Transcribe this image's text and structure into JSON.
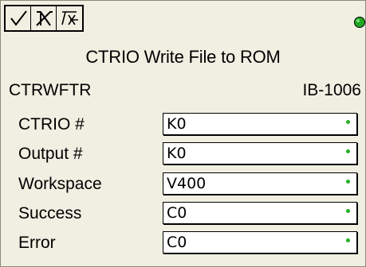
{
  "toolbar": {
    "buttons": [
      {
        "name": "accept-button",
        "icon": "check-icon"
      },
      {
        "name": "cancel-button",
        "icon": "x-icon"
      },
      {
        "name": "help-button",
        "icon": "help-icon"
      }
    ],
    "status_color": "#22a822"
  },
  "title": "CTRIO Write File to ROM",
  "mnemonic": "CTRWFTR",
  "ib_number": "IB-1006",
  "params": [
    {
      "label": "CTRIO #",
      "value": "K0"
    },
    {
      "label": "Output #",
      "value": "K0"
    },
    {
      "label": "Workspace",
      "value": "V400"
    },
    {
      "label": "Success",
      "value": "C0"
    },
    {
      "label": "Error",
      "value": "C0"
    }
  ]
}
